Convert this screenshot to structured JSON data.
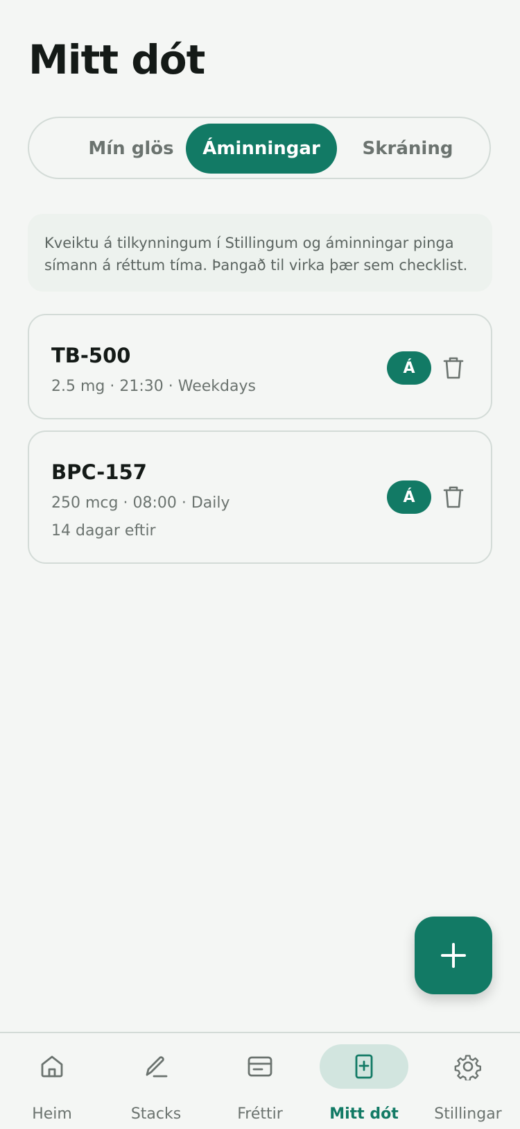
{
  "header": {
    "title": "Mitt dót"
  },
  "tabs": [
    {
      "label": "Mín glös",
      "active": false
    },
    {
      "label": "Áminningar",
      "active": true
    },
    {
      "label": "Skráning",
      "active": false
    }
  ],
  "info_text": "Kveiktu á tilkynningum í Stillingum og áminningar pinga símann á réttum tíma. Þangað til virka þær sem checklist.",
  "reminders": [
    {
      "name": "TB-500",
      "details": "2.5 mg · 21:30 · Weekdays",
      "toggle_label": "Á",
      "delete_icon": "trash-icon"
    },
    {
      "name": "BPC-157",
      "details": "250 mcg · 08:00 · Daily",
      "remaining": "14 dagar eftir",
      "toggle_label": "Á",
      "delete_icon": "trash-icon"
    }
  ],
  "fab": {
    "icon": "plus-icon"
  },
  "bottom_nav": [
    {
      "label": "Heim",
      "icon": "home-icon",
      "active": false
    },
    {
      "label": "Stacks",
      "icon": "pencil-icon",
      "active": false
    },
    {
      "label": "Fréttir",
      "icon": "news-icon",
      "active": false
    },
    {
      "label": "Mitt dót",
      "icon": "vial-plus-icon",
      "active": true
    },
    {
      "label": "Stillingar",
      "icon": "gear-icon",
      "active": false
    }
  ],
  "colors": {
    "accent": "#127a65",
    "background": "#f4f6f4",
    "nav_active_bg": "#d2e5df",
    "muted_text": "#6b736f",
    "border": "#d3dbd7"
  }
}
